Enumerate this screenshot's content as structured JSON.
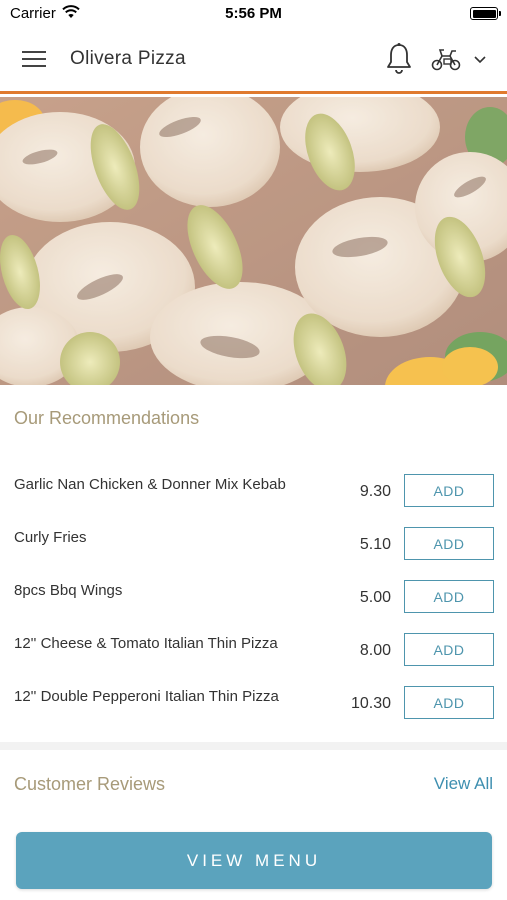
{
  "status_bar": {
    "carrier": "Carrier",
    "time": "5:56 PM"
  },
  "header": {
    "title": "Olivera Pizza",
    "accent_color": "#e07a2e",
    "icons": [
      "menu-icon",
      "bell-icon",
      "scooter-icon",
      "chevron-down-icon"
    ]
  },
  "hero": {
    "image_subject": "grilled chicken kebab skewers with leeks and peppers"
  },
  "recommendations": {
    "title": "Our Recommendations",
    "add_label": "ADD",
    "items": [
      {
        "name": "Garlic Nan Chicken & Donner Mix Kebab",
        "price": "9.30"
      },
      {
        "name": "Curly Fries",
        "price": "5.10"
      },
      {
        "name": "8pcs Bbq Wings",
        "price": "5.00"
      },
      {
        "name": "12'' Cheese & Tomato Italian Thin Pizza",
        "price": "8.00"
      },
      {
        "name": "12'' Double Pepperoni Italian Thin Pizza",
        "price": "10.30"
      }
    ]
  },
  "reviews": {
    "title": "Customer Reviews",
    "view_all": "View All"
  },
  "footer": {
    "view_menu": "VIEW MENU",
    "button_color": "#5ba3bd"
  }
}
